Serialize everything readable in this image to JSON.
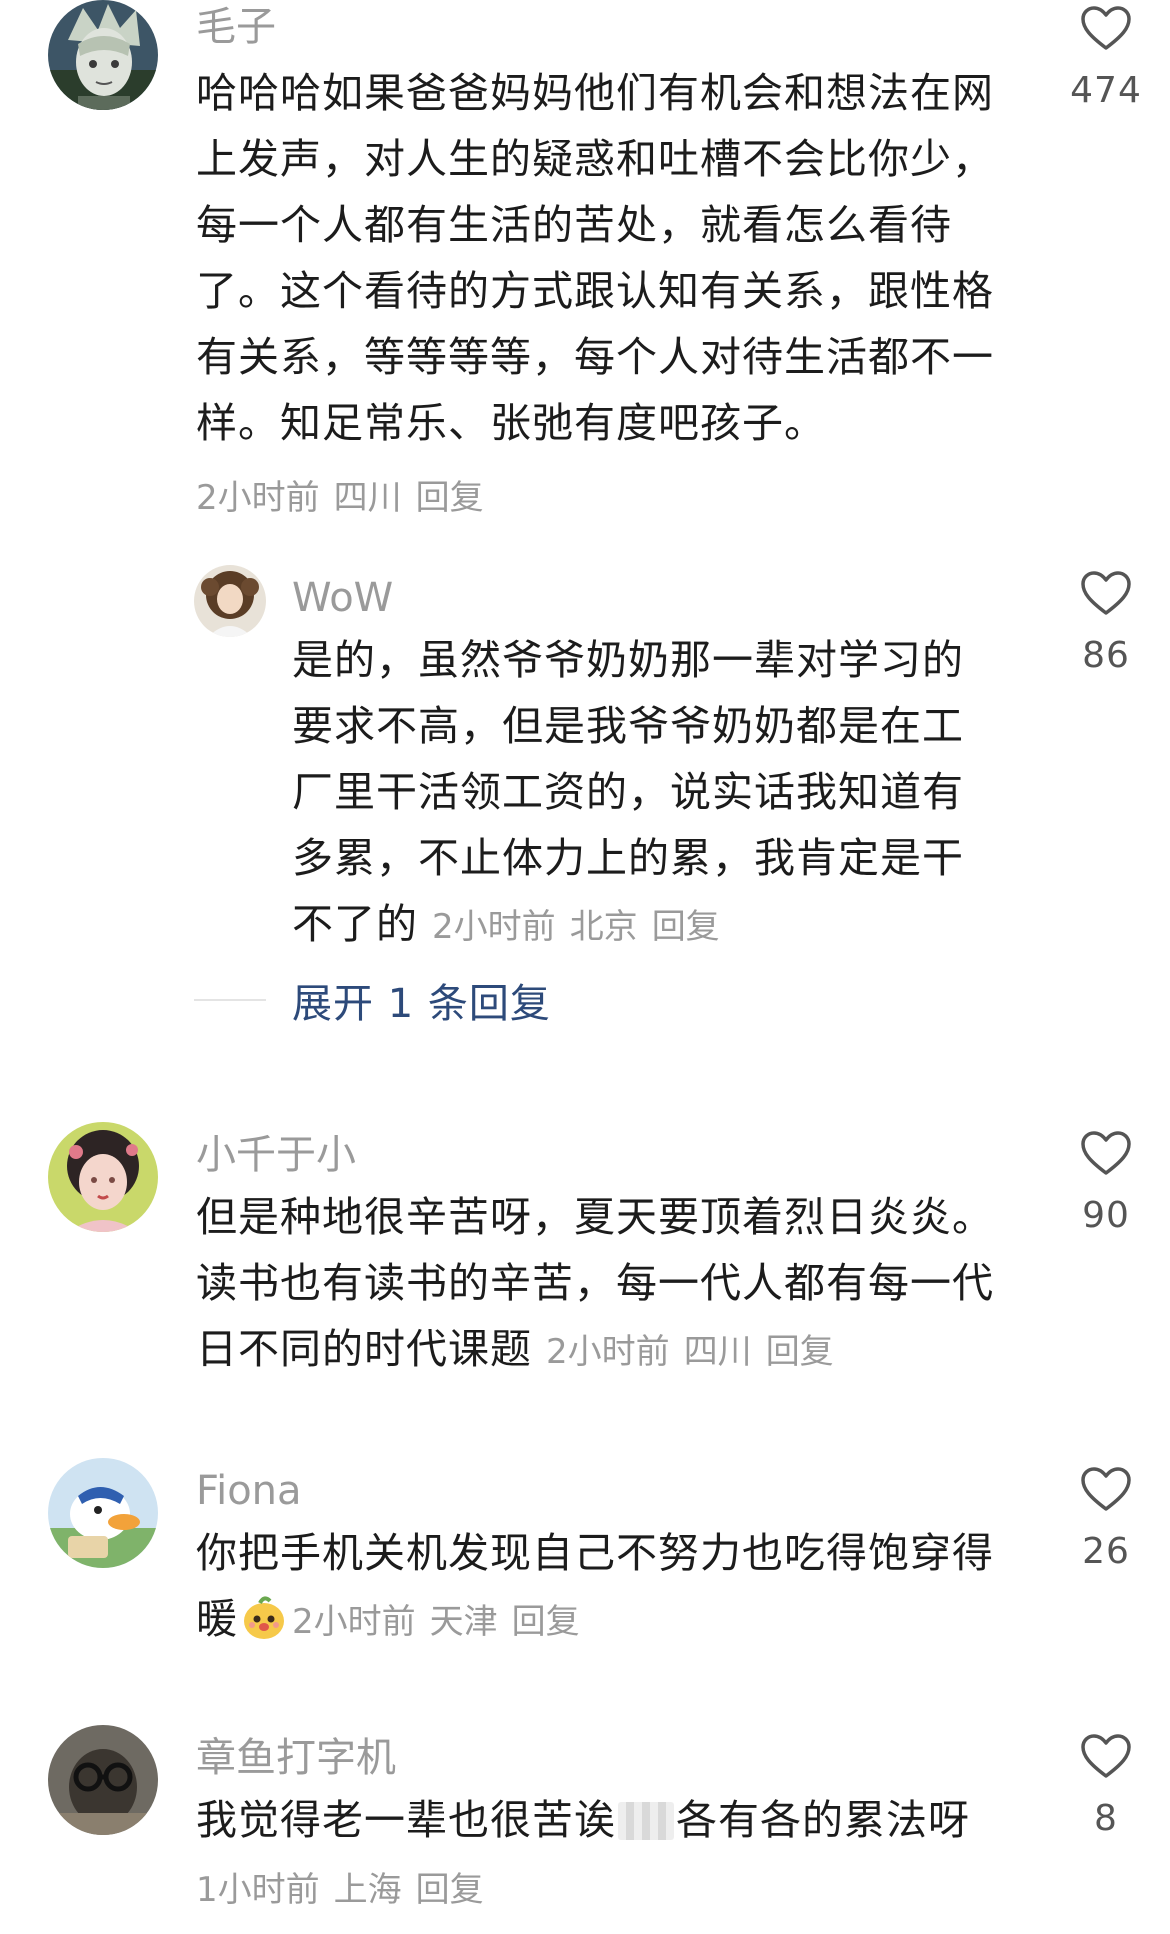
{
  "comments": [
    {
      "username": "毛子",
      "lines": [
        "哈哈哈如果爸爸妈妈他们有机会和想法在网",
        "上发声，对人生的疑惑和吐槽不会比你少，",
        "每一个人都有生活的苦处，就看怎么看待",
        "了。这个看待的方式跟认知有关系，跟性格",
        "有关系，等等等等，每个人对待生活都不一",
        "样。知足常乐、张弛有度吧孩子。"
      ],
      "time": "2小时前",
      "location": "四川",
      "reply": "回复",
      "likes": "474",
      "avatar_icon": "anime-gray-hair-avatar"
    },
    {
      "username": "WoW",
      "lines": [
        "是的，虽然爷爷奶奶那一辈对学习的",
        "要求不高，但是我爷爷奶奶都是在工",
        "厂里干活领工资的，说实话我知道有",
        "多累，不止体力上的累，我肯定是干",
        "不了的"
      ],
      "time": "2小时前",
      "location": "北京",
      "reply": "回复",
      "likes": "86",
      "avatar_icon": "curly-hair-girl-avatar"
    },
    {
      "username": "小千于小",
      "lines": [
        "但是种地很辛苦呀，夏天要顶着烈日炎炎。",
        "读书也有读书的辛苦，每一代人都有每一代",
        "日不同的时代课题"
      ],
      "time": "2小时前",
      "location": "四川",
      "reply": "回复",
      "likes": "90",
      "avatar_icon": "painted-girl-avatar"
    },
    {
      "username": "Fiona",
      "lines": [
        "你把手机关机发现自己不努力也吃得饱穿得",
        "暖"
      ],
      "emoji": "smiling-peach-emoji",
      "time": "2小时前",
      "location": "天津",
      "reply": "回复",
      "likes": "26",
      "avatar_icon": "cartoon-duck-avatar"
    },
    {
      "username": "章鱼打字机",
      "text_before": "我觉得老一辈也很苦诶",
      "text_after": "各有各的累法呀",
      "time": "1小时前",
      "location": "上海",
      "reply": "回复",
      "likes": "8",
      "avatar_icon": "glasses-person-avatar"
    }
  ],
  "expand_replies": "展开 1 条回复",
  "icons": {
    "like": "heart-outline-icon"
  },
  "colors": {
    "username": "#9a9a9a",
    "body": "#1c1c1c",
    "meta": "#9a9a9a",
    "expand": "#2d4a7a",
    "like_count": "#555555"
  }
}
